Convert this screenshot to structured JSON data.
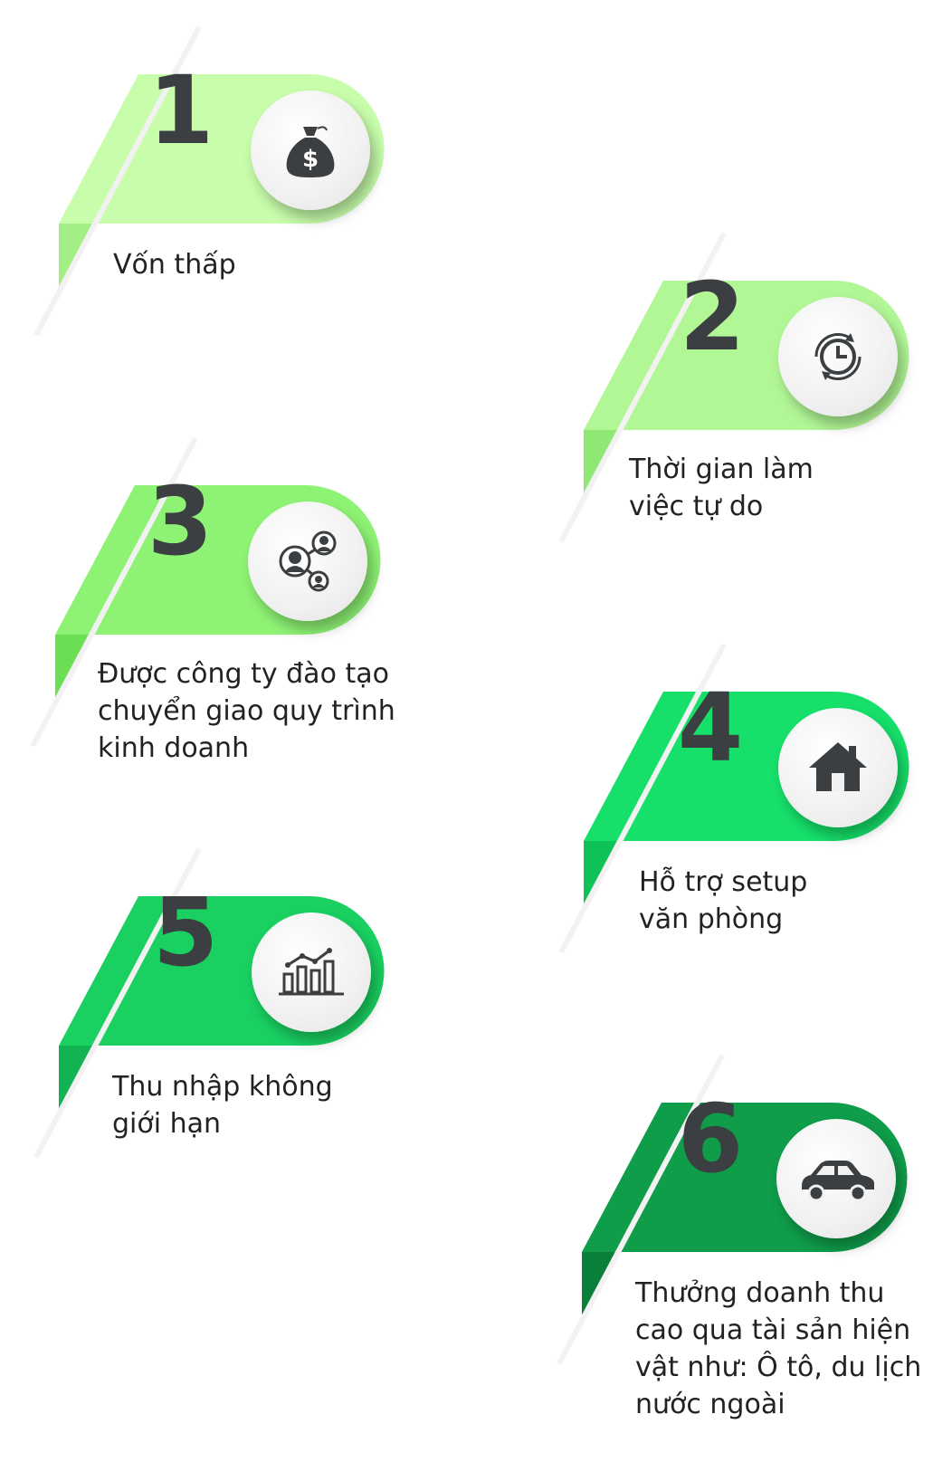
{
  "steps": [
    {
      "number": "1",
      "text": "Vốn thấp",
      "color": "#c7fdab",
      "icon": "money-bag-icon"
    },
    {
      "number": "2",
      "text_lines": [
        "Thời gian làm",
        "việc tự do"
      ],
      "color": "#b2f796",
      "icon": "clock-refresh-icon"
    },
    {
      "number": "3",
      "text_lines": [
        "Được công ty đào tạo",
        "chuyển giao quy trình",
        "kinh doanh"
      ],
      "color": "#8ef374",
      "icon": "network-people-icon"
    },
    {
      "number": "4",
      "text_lines": [
        "Hỗ trợ setup",
        "văn phòng"
      ],
      "color": "#16e06a",
      "icon": "house-icon"
    },
    {
      "number": "5",
      "text_lines": [
        "Thu nhập không",
        "giới hạn"
      ],
      "color": "#1ad061",
      "icon": "bar-chart-icon"
    },
    {
      "number": "6",
      "text_lines": [
        "Thưởng doanh thu",
        "cao qua tài sản hiện",
        "vật như: Ô tô, du lịch",
        "nước ngoài"
      ],
      "color": "#0f9d4a",
      "icon": "car-icon"
    }
  ]
}
